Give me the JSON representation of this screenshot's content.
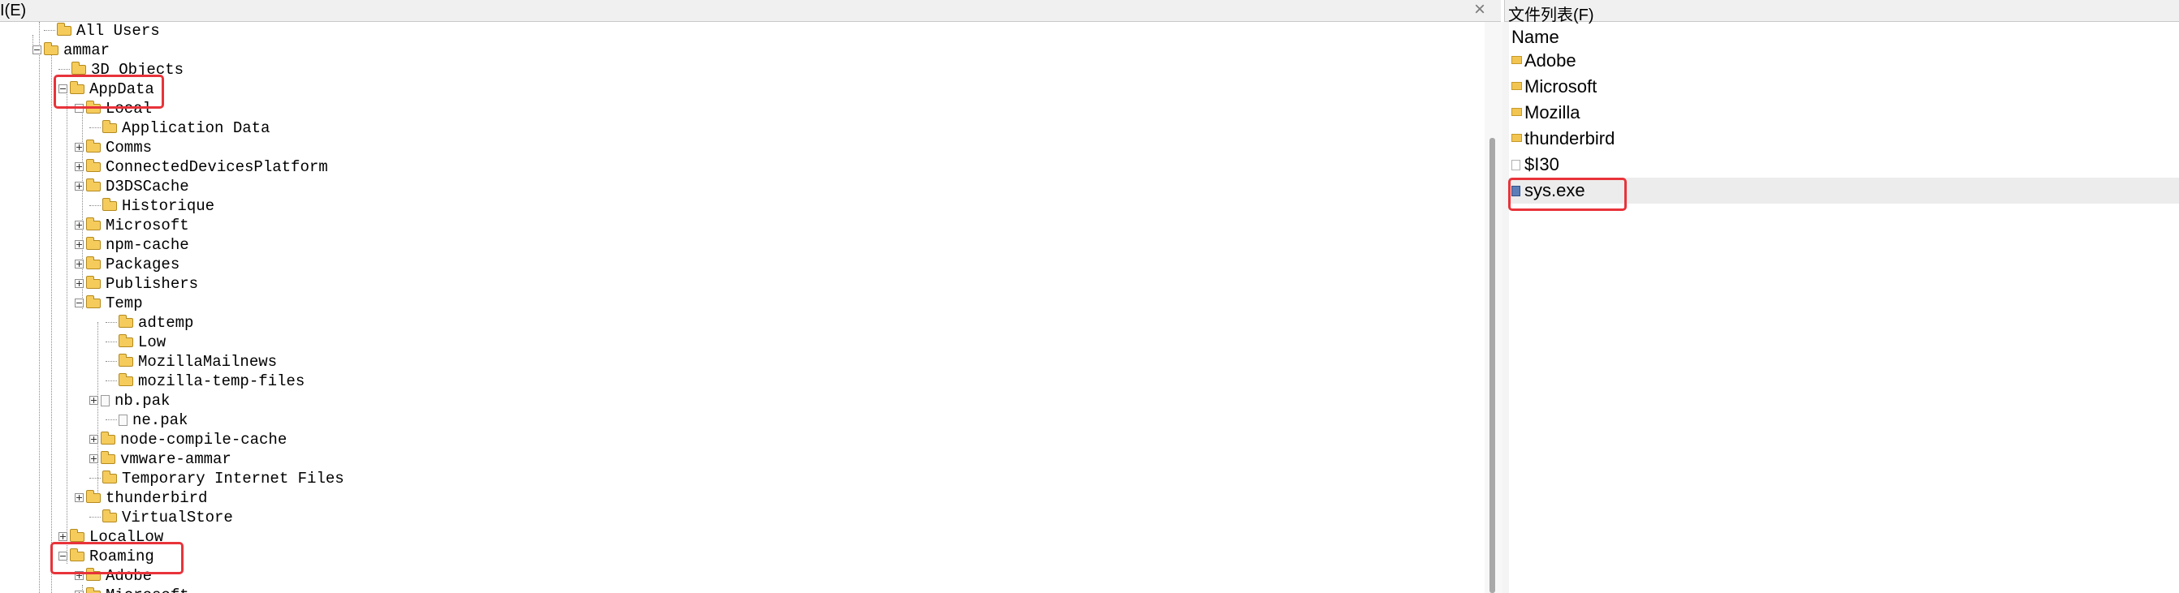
{
  "left_pane": {
    "title": "I(E)"
  },
  "right_pane": {
    "title": "文件列表(F)",
    "column_header": "Name"
  },
  "tree": [
    {
      "label": "All Users",
      "icon": "folder-icon",
      "expander": "none"
    },
    {
      "label": "ammar",
      "icon": "folder-icon",
      "expander": "minus"
    },
    {
      "label": "3D Objects",
      "icon": "folder-icon",
      "expander": "none"
    },
    {
      "label": "AppData",
      "icon": "folder-icon",
      "expander": "minus"
    },
    {
      "label": "Local",
      "icon": "folder-icon",
      "expander": "minus"
    },
    {
      "label": "Application Data",
      "icon": "folder-icon",
      "expander": "none"
    },
    {
      "label": "Comms",
      "icon": "folder-icon",
      "expander": "plus"
    },
    {
      "label": "ConnectedDevicesPlatform",
      "icon": "folder-icon",
      "expander": "plus"
    },
    {
      "label": "D3DSCache",
      "icon": "folder-icon",
      "expander": "plus"
    },
    {
      "label": "Historique",
      "icon": "folder-icon",
      "expander": "none"
    },
    {
      "label": "Microsoft",
      "icon": "folder-icon",
      "expander": "plus"
    },
    {
      "label": "npm-cache",
      "icon": "folder-icon",
      "expander": "plus"
    },
    {
      "label": "Packages",
      "icon": "folder-icon",
      "expander": "plus"
    },
    {
      "label": "Publishers",
      "icon": "folder-icon",
      "expander": "plus"
    },
    {
      "label": "Temp",
      "icon": "folder-icon",
      "expander": "minus"
    },
    {
      "label": "adtemp",
      "icon": "folder-icon",
      "expander": "none"
    },
    {
      "label": "Low",
      "icon": "folder-icon",
      "expander": "none"
    },
    {
      "label": "MozillaMailnews",
      "icon": "folder-icon",
      "expander": "none"
    },
    {
      "label": "mozilla-temp-files",
      "icon": "folder-icon",
      "expander": "none"
    },
    {
      "label": "nb.pak",
      "icon": "file-icon",
      "expander": "plus"
    },
    {
      "label": "ne.pak",
      "icon": "file-icon",
      "expander": "none"
    },
    {
      "label": "node-compile-cache",
      "icon": "folder-icon",
      "expander": "plus"
    },
    {
      "label": "vmware-ammar",
      "icon": "folder-icon",
      "expander": "plus"
    },
    {
      "label": "Temporary Internet Files",
      "icon": "folder-icon",
      "expander": "none"
    },
    {
      "label": "thunderbird",
      "icon": "folder-icon",
      "expander": "plus"
    },
    {
      "label": "VirtualStore",
      "icon": "folder-icon",
      "expander": "none"
    },
    {
      "label": "LocalLow",
      "icon": "folder-icon",
      "expander": "plus"
    },
    {
      "label": "Roaming",
      "icon": "folder-icon",
      "expander": "minus"
    },
    {
      "label": "Adobe",
      "icon": "folder-icon",
      "expander": "plus"
    },
    {
      "label": "Microsoft",
      "icon": "folder-icon",
      "expander": "plus"
    }
  ],
  "files": [
    {
      "name": "Adobe",
      "icon": "folder-icon"
    },
    {
      "name": "Microsoft",
      "icon": "folder-icon"
    },
    {
      "name": "Mozilla",
      "icon": "folder-icon"
    },
    {
      "name": "thunderbird",
      "icon": "folder-icon"
    },
    {
      "name": "$I30",
      "icon": "file-icon"
    },
    {
      "name": "sys.exe",
      "icon": "exe-icon",
      "selected": true
    }
  ],
  "colors": {
    "highlight": "#e8333a",
    "folder": "#f5cc5b",
    "selection": "#ececec"
  }
}
